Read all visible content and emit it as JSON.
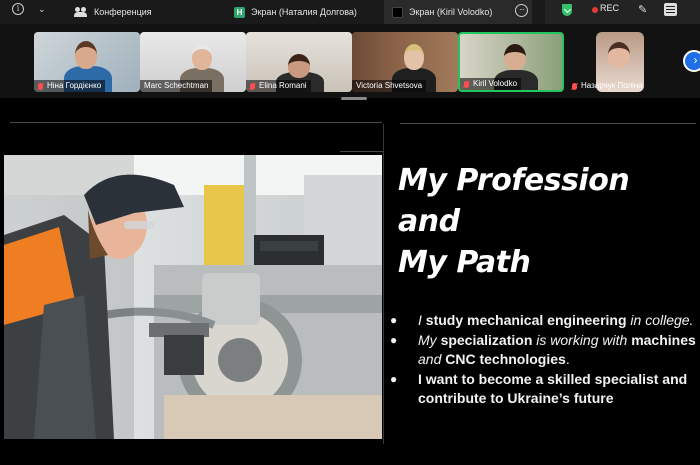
{
  "topbar": {
    "tabs": [
      {
        "label": "Конференция",
        "icon": "people-icon"
      },
      {
        "label": "Экран (Наталия Долгова)",
        "icon": "h-avatar-icon",
        "badge": "H"
      },
      {
        "label": "Экран (Kiril Volodko)",
        "icon": "screen-icon"
      }
    ],
    "recording_label": "REC",
    "accent_green": "#22c55e",
    "recording_color": "#e53935"
  },
  "participants": [
    {
      "name": "Ніна Гордієнко",
      "muted": true
    },
    {
      "name": "Marc Schechtman",
      "muted": false
    },
    {
      "name": "Elina Romani",
      "muted": true
    },
    {
      "name": "Victoria Shvetsova",
      "muted": false
    },
    {
      "name": "Kiril Volodko",
      "muted": true,
      "active": true
    },
    {
      "name": "Назарчук Поліна",
      "muted": true
    }
  ],
  "slide": {
    "title_line1": "My Profession and",
    "title_line2": "My Path",
    "bullets": [
      {
        "p1": "I ",
        "p2": "study mechanical engineering",
        "p3": " in college."
      },
      {
        "p1": "My ",
        "p2": "specialization",
        "p3": " is working with ",
        "p4": "machines",
        "p5": " and ",
        "p6": "CNC technologies",
        "p7": "."
      },
      {
        "p1": "I want to become a skilled specialist and contribute to Ukraine’s future"
      }
    ]
  }
}
